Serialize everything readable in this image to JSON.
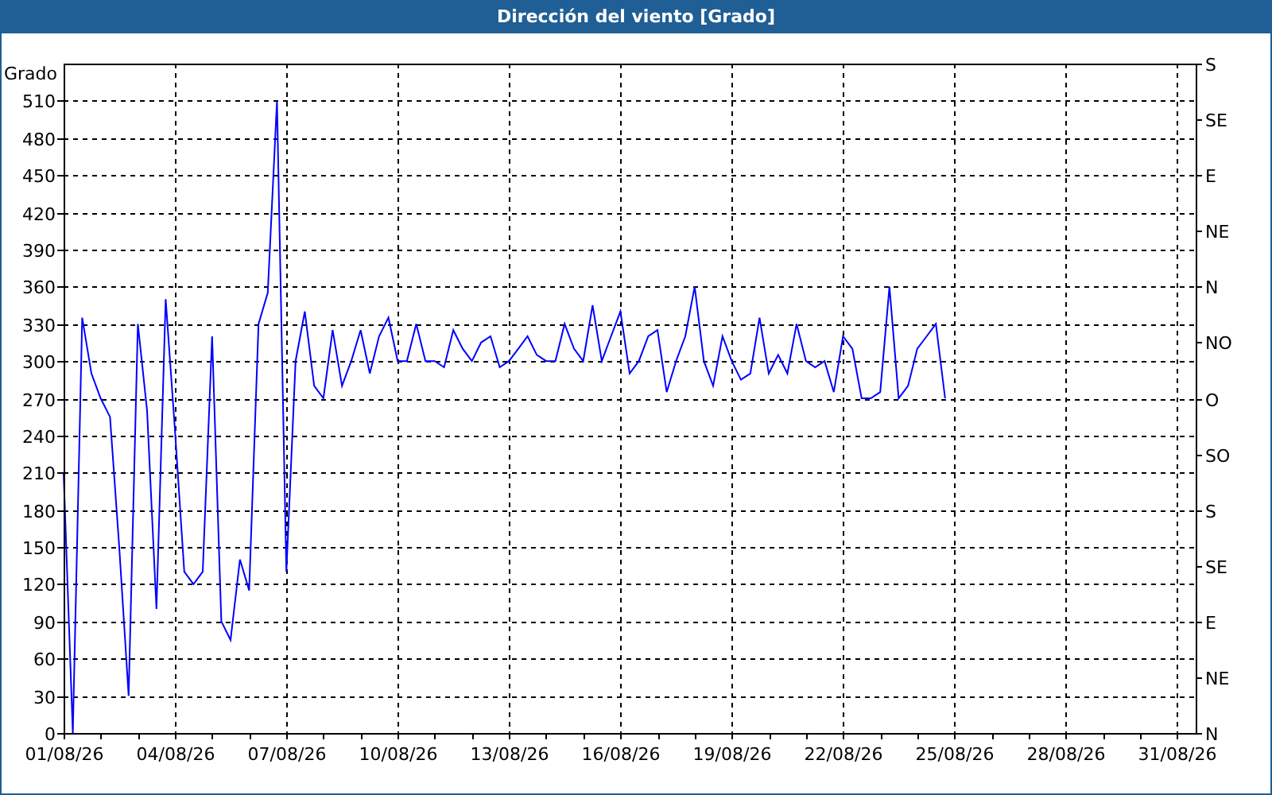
{
  "window": {
    "title": "Dirección del viento [Grado]"
  },
  "chart": {
    "right_axis_labels": [
      "S",
      "SE",
      "E",
      "NE",
      "N",
      "NO",
      "O",
      "SO",
      "S",
      "SE",
      "E",
      "NE",
      "N"
    ],
    "chart_data": {
      "type": "line",
      "ylabel": "Grado",
      "ylim": [
        0,
        540
      ],
      "grid": true,
      "yticks": [
        0,
        30,
        60,
        90,
        120,
        150,
        180,
        210,
        240,
        270,
        300,
        330,
        360,
        390,
        420,
        450,
        480,
        510
      ],
      "categories": [
        "01/08/26",
        null,
        null,
        null,
        null,
        null,
        null,
        null,
        null,
        null,
        null,
        null,
        "04/08/26",
        null,
        null,
        null,
        null,
        null,
        null,
        null,
        null,
        null,
        null,
        null,
        "07/08/26",
        null,
        null,
        null,
        null,
        null,
        null,
        null,
        null,
        null,
        null,
        null,
        "10/08/26",
        null,
        null,
        null,
        null,
        null,
        null,
        null,
        null,
        null,
        null,
        null,
        "13/08/26",
        null,
        null,
        null,
        null,
        null,
        null,
        null,
        null,
        null,
        null,
        null,
        "16/08/26",
        null,
        null,
        null,
        null,
        null,
        null,
        null,
        null,
        null,
        null,
        null,
        "19/08/26",
        null,
        null,
        null,
        null,
        null,
        null,
        null,
        null,
        null,
        null,
        null,
        "22/08/26",
        null,
        null,
        null,
        null,
        null,
        null,
        null,
        null,
        null,
        null,
        null,
        "25/08/26",
        null,
        null,
        null,
        null,
        null,
        null,
        null,
        null,
        null,
        null,
        null,
        "28/08/26",
        null,
        null,
        null,
        null,
        null,
        null,
        null,
        null,
        null,
        null,
        null,
        "31/08/26",
        null,
        null
      ],
      "series": [
        {
          "color": "#0000ff",
          "values": [
            210,
            0,
            335,
            290,
            270,
            255,
            150,
            30,
            330,
            260,
            100,
            350,
            245,
            130,
            120,
            130,
            320,
            90,
            75,
            140,
            115,
            330,
            355,
            510,
            130,
            300,
            340,
            280,
            270,
            325,
            280,
            300,
            325,
            290,
            320,
            335,
            300,
            300,
            330,
            300,
            300,
            295,
            325,
            310,
            300,
            315,
            320,
            295,
            300,
            310,
            320,
            305,
            300,
            300,
            330,
            310,
            300,
            345,
            300,
            320,
            340,
            290,
            300,
            320,
            325,
            275,
            300,
            320,
            360,
            300,
            280,
            320,
            300,
            285,
            290,
            335,
            290,
            305,
            290,
            330,
            300,
            295,
            300,
            275,
            320,
            310,
            270,
            270,
            275,
            360,
            270,
            280,
            310,
            320,
            330,
            270,
            null,
            null,
            null,
            null,
            null,
            null,
            null,
            null,
            null,
            null,
            null,
            null,
            null,
            null,
            null,
            null,
            null,
            null,
            null,
            null,
            null,
            null,
            null,
            null,
            null,
            null,
            null
          ]
        }
      ]
    }
  }
}
